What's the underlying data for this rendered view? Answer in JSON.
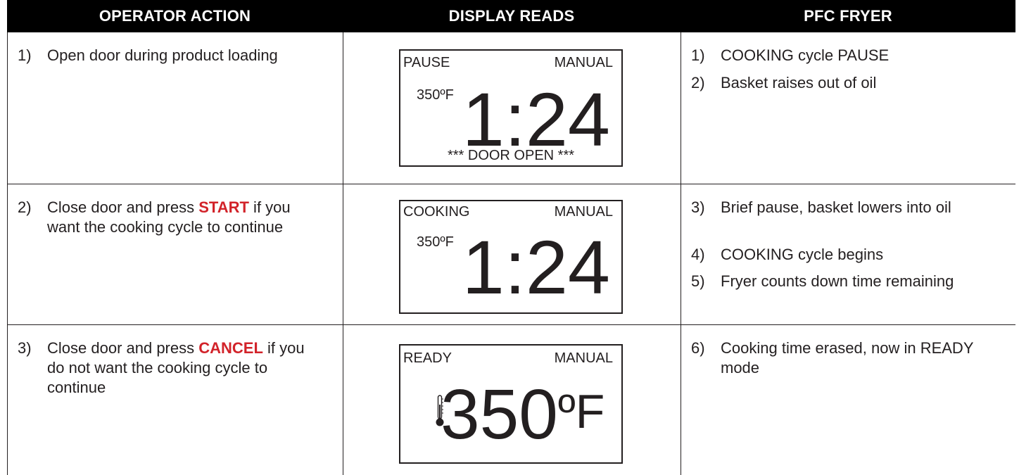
{
  "headers": {
    "operator_action": "OPERATOR ACTION",
    "display_reads": "DISPLAY READS",
    "pfc_fryer": "PFC FRYER"
  },
  "rows": [
    {
      "action": {
        "num": "1)",
        "text": "Open door during product loading"
      },
      "display": {
        "status": "PAUSE",
        "mode": "MANUAL",
        "temp": "350ºF",
        "time": "1:24",
        "message": "*** DOOR OPEN ***"
      },
      "fryer": [
        {
          "num": "1)",
          "text": "COOKING cycle PAUSE"
        },
        {
          "num": "2)",
          "text": "Basket raises out of oil"
        }
      ]
    },
    {
      "action": {
        "num": "2)",
        "pre": "Close door and press ",
        "keyword": "START",
        "post": " if you want the cooking cycle to continue"
      },
      "display": {
        "status": "COOKING",
        "mode": "MANUAL",
        "temp": "350ºF",
        "time": "1:24"
      },
      "fryer": [
        {
          "num": "3)",
          "text": "Brief pause, basket lowers into oil"
        },
        {
          "num": "4)",
          "text": "COOKING cycle begins"
        },
        {
          "num": "5)",
          "text": "Fryer counts down time remaining"
        }
      ]
    },
    {
      "action": {
        "num": "3)",
        "pre": "Close door and press ",
        "keyword": "CANCEL",
        "post": " if you do not want the cooking cycle to continue"
      },
      "display": {
        "status": "READY",
        "mode": "MANUAL",
        "temp_value": "350",
        "temp_unit": "ºF",
        "icon": "thermometer-icon"
      },
      "fryer": [
        {
          "num": "6)",
          "text": "Cooking time erased, now in READY mode"
        }
      ]
    }
  ],
  "colors": {
    "header_bg": "#000000",
    "header_text": "#ffffff",
    "keyword": "#d2232a",
    "text": "#231f20"
  }
}
